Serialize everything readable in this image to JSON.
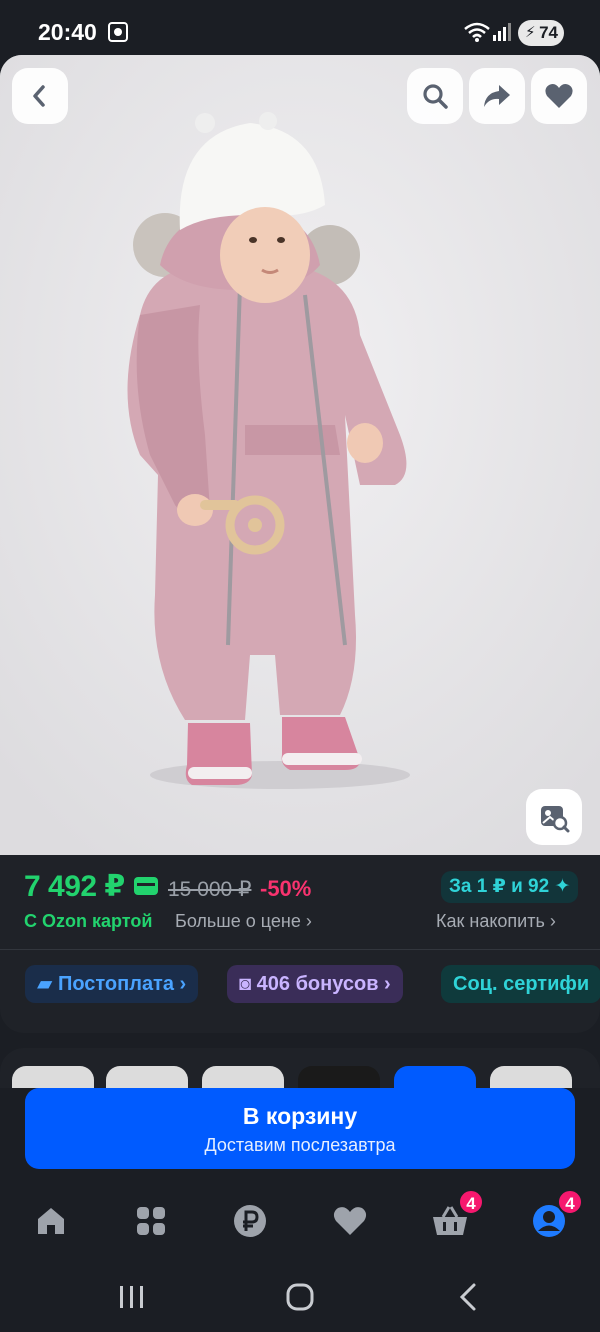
{
  "status": {
    "time": "20:40",
    "battery": "74"
  },
  "product": {
    "image_alt": "Комбинезон детский розовый",
    "price": "7 492 ₽",
    "old_price": "15 000 ₽",
    "discount": "-50%",
    "ozon_card_label": "С Ozon картой",
    "more_about_price": "Больше о цене ›",
    "reward": "За 1 ₽ и 92",
    "how_to_save": "Как накопить ›"
  },
  "chips": [
    {
      "label": "Постоплата ›"
    },
    {
      "label": "406 бонусов ›"
    },
    {
      "label": "Соц. сертифи"
    }
  ],
  "cart": {
    "title": "В корзину",
    "subtitle": "Доставим послезавтра"
  },
  "nav": {
    "items": [
      {
        "name": "home"
      },
      {
        "name": "catalog"
      },
      {
        "name": "ozon-bank"
      },
      {
        "name": "favorites"
      },
      {
        "name": "cart",
        "badge": "4"
      },
      {
        "name": "profile",
        "badge": "4"
      }
    ]
  },
  "colors": {
    "price_green": "#22d36e",
    "discount_pink": "#f8336f",
    "accent_blue": "#005bff",
    "background": "#1b1e24"
  }
}
